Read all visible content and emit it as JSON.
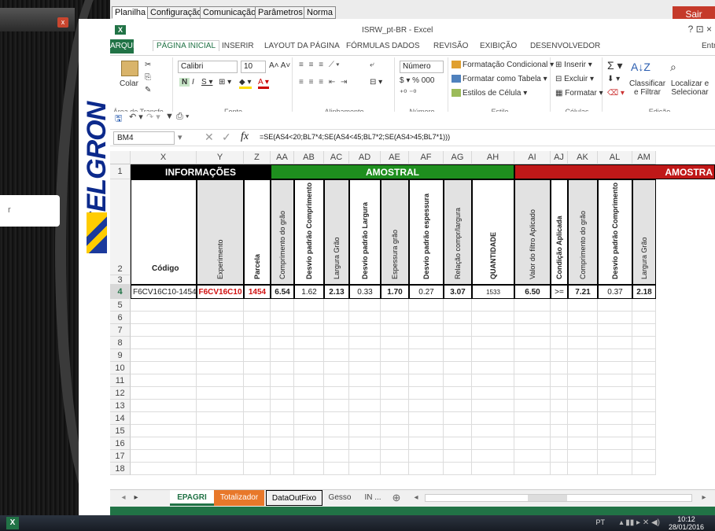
{
  "top_tabs": {
    "planilha": "Planilha",
    "configuracao": "Configuração",
    "comunicacao": "Comunicação",
    "parametros": "Parâmetros",
    "norma": "Norma",
    "sair": "Sair"
  },
  "logo": {
    "text": "SELGRON"
  },
  "excel": {
    "title": "ISRW_pt-BR - Excel",
    "window_controls": "?  ⊡  ×",
    "ribbon_tabs": [
      "ARQUIVO",
      "PÁGINA INICIAL",
      "INSERIR",
      "LAYOUT DA PÁGINA",
      "FÓRMULAS",
      "DADOS",
      "REVISÃO",
      "EXIBIÇÃO",
      "DESENVOLVEDOR"
    ],
    "ribbon_right": "Entr",
    "ribbon": {
      "paste": "Colar",
      "clipboard": "Área de Transfe...",
      "font_name": "Calibri",
      "font_size": "10",
      "font_group": "Fonte",
      "align_group": "Alinhamento",
      "number_format": "Número",
      "number_group": "Número",
      "cond_format": "Formatação Condicional",
      "table_format": "Formatar como Tabela",
      "cell_styles": "Estilos de Célula",
      "style_group": "Estilo",
      "insert": "Inserir",
      "delete": "Excluir",
      "format": "Formatar",
      "cells_group": "Células",
      "sort": "Classificar e Filtrar",
      "find": "Localizar e Selecionar",
      "edit_group": "Edição"
    },
    "name_box": "BM4",
    "formula": "=SE(AS4<20;BL7*4;SE(AS4<45;BL7*2;SE(AS4>45;BL7*1)))",
    "columns": [
      "X",
      "Y",
      "Z",
      "AA",
      "AB",
      "AC",
      "AD",
      "AE",
      "AF",
      "AG",
      "AH",
      "AI",
      "AJ",
      "AK",
      "AL",
      "AM"
    ],
    "rows": [
      "1",
      "2",
      "3",
      "4",
      "5",
      "6",
      "7",
      "8",
      "9",
      "10",
      "11",
      "12",
      "13",
      "14",
      "15",
      "16",
      "17",
      "18"
    ],
    "row1": {
      "informacoes": "INFORMAÇÕES",
      "amostral": "AMOSTRAL",
      "amostral2": "AMOSTRA"
    },
    "headers": {
      "codigo": "Código",
      "experimento": "Experimento",
      "parcela": "Parcela",
      "comp_grao": "Comprimento do grão",
      "desvio_comp": "Desvio padrão Comprimento",
      "largura": "Largura Grão",
      "desvio_larg": "Desvio padrão Largura",
      "espessura": "Espessura grão",
      "desvio_esp": "Desvio padrão espessura",
      "relacao": "Relação compr/largura",
      "quantidade": "QUANTIDADE",
      "valor_filtro": "Valor do filtro Aplicado",
      "condicao": "Condição Aplicada",
      "comp_grao2": "Comprimento do grão",
      "desvio_comp2": "Desvio padrão Comprimento",
      "largura2": "Largura Grão"
    },
    "row4": [
      "F6CV16C10-1454",
      "F6CV16C10",
      "1454",
      "6.54",
      "1.62",
      "2.13",
      "0.33",
      "1.70",
      "0.27",
      "3.07",
      "1533",
      "6.50",
      ">=",
      "7.21",
      "0.37",
      "2.18"
    ],
    "sheet_tabs": [
      "EPAGRI",
      "Totalizador",
      "DataOutFixo",
      "Gesso",
      "IN ..."
    ]
  },
  "taskbar": {
    "lang": "PT",
    "time": "10:12",
    "date": "28/01/2016",
    "app": "X"
  },
  "left_panel": {
    "close": "x",
    "field_hint": "r"
  },
  "colors": {
    "green": "#1e8f1e",
    "red": "#c01818",
    "black": "#000000",
    "orange": "#e8782a",
    "excel": "#217346"
  }
}
